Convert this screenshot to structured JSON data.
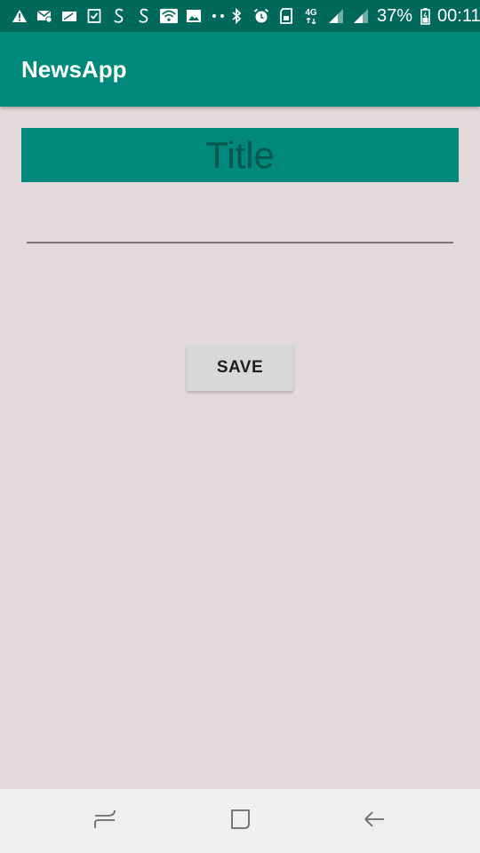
{
  "status_bar": {
    "network": "4G",
    "battery": "37%",
    "time": "00:11",
    "icons_left": [
      "warning-icon",
      "mail-settings-icon",
      "card-icon",
      "checklist-icon",
      "app-s-icon",
      "app-s-icon",
      "wifi-icon",
      "image-icon",
      "more-dots-icon"
    ],
    "icons_right": [
      "bluetooth-icon",
      "alarm-icon",
      "sim-icon",
      "network-4g-icon",
      "signal-icon",
      "signal-icon",
      "battery-icon"
    ]
  },
  "app_bar": {
    "title": "NewsApp"
  },
  "main": {
    "title_banner": "Title",
    "input": {
      "value": "",
      "placeholder": ""
    },
    "save_label": "SAVE"
  },
  "nav_bar": {
    "buttons": [
      "recent-apps-icon",
      "home-icon",
      "back-icon"
    ]
  },
  "colors": {
    "status_bar": "#00695C",
    "app_bar": "#00897B",
    "background": "#E4D9DA",
    "button": "#D8D8D8"
  }
}
